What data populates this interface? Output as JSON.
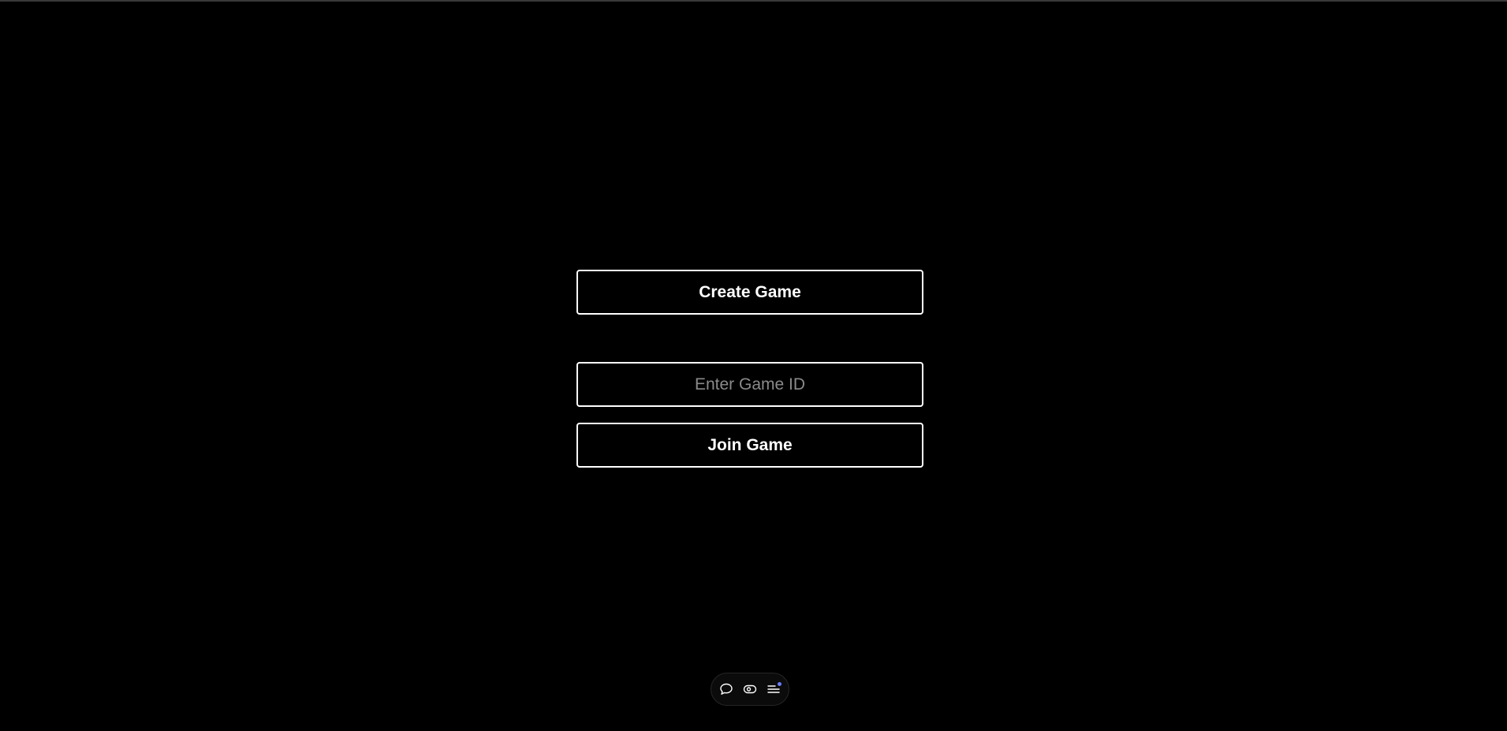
{
  "main": {
    "create_label": "Create Game",
    "game_id_placeholder": "Enter Game ID",
    "game_id_value": "",
    "join_label": "Join Game"
  },
  "toolbar": {
    "items": [
      {
        "icon": "chat-bubble-icon"
      },
      {
        "icon": "eye-icon"
      },
      {
        "icon": "menu-list-icon",
        "badge_color": "#6b7cff"
      }
    ]
  },
  "colors": {
    "background": "#000000",
    "foreground": "#ffffff",
    "placeholder": "#8a8a8a",
    "badge": "#6b7cff"
  }
}
